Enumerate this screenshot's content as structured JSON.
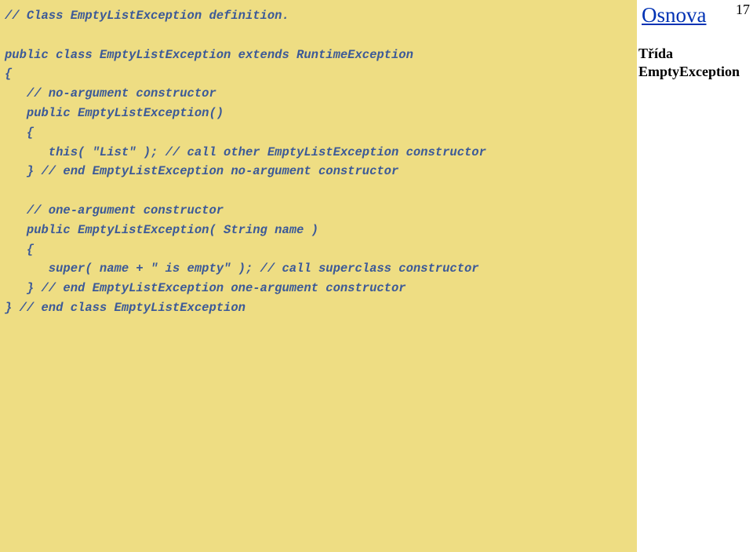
{
  "page_number": "17",
  "sidebar": {
    "heading": "Osnova",
    "label_line1": "Třída",
    "label_line2": "EmptyException"
  },
  "code": {
    "l01": "// Class EmptyListException definition.",
    "l02": "",
    "l03": "public class EmptyListException extends RuntimeException ",
    "l04": "{",
    "l05": "   // no-argument constructor",
    "l06": "   public EmptyListException()",
    "l07": "   {",
    "l08": "      this( \"List\" ); // call other EmptyListException constructor",
    "l09": "   } // end EmptyListException no-argument constructor",
    "l10": "",
    "l11": "   // one-argument constructor",
    "l12": "   public EmptyListException( String name )",
    "l13": "   {",
    "l14": "      super( name + \" is empty\" ); // call superclass constructor",
    "l15": "   } // end EmptyListException one-argument constructor",
    "l16": "} // end class EmptyListException"
  }
}
